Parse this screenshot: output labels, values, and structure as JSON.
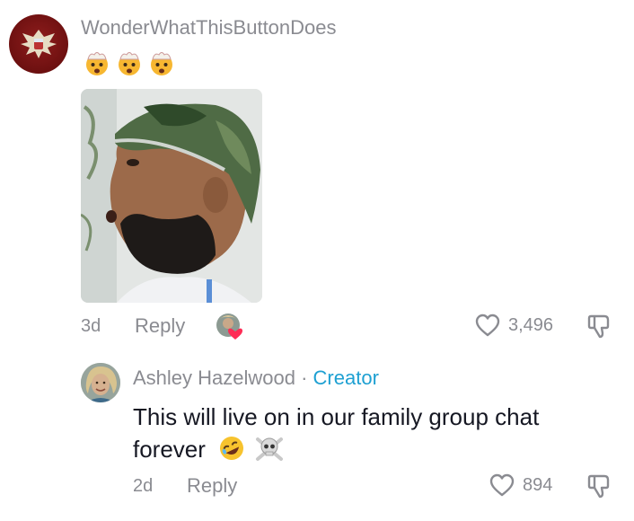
{
  "comment1": {
    "username": "WonderWhatThisButtonDoes",
    "emojis": [
      "exploding-head-emoji",
      "exploding-head-emoji",
      "exploding-head-emoji"
    ],
    "age": "3d",
    "reply_label": "Reply",
    "like_count": "3,496"
  },
  "comment2": {
    "name": "Ashley Hazelwood",
    "separator": " · ",
    "badge": "Creator",
    "text": "This will live on in our family group chat forever",
    "emojis": [
      "rolling-laughing-emoji",
      "skull-crossbones-emoji"
    ],
    "age": "2d",
    "reply_label": "Reply",
    "like_count": "894"
  },
  "colors": {
    "secondary_text": "#8a8b91",
    "creator_badge": "#1ea0d2",
    "liked_heart": "#fe2c55"
  }
}
